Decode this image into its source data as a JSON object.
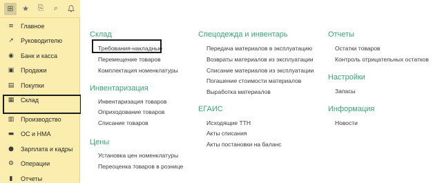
{
  "sidebar": {
    "toolbar": [
      {
        "icon": "grid-icon",
        "glyph": "⊞"
      },
      {
        "icon": "star-icon",
        "glyph": "★"
      },
      {
        "icon": "history-icon",
        "glyph": "⎘"
      },
      {
        "icon": "search-icon",
        "glyph": "⌕"
      },
      {
        "icon": "bell-icon",
        "glyph": "🔔"
      }
    ],
    "items": [
      {
        "label": "Главное",
        "glyph": "≡",
        "name": "sidebar-item-main"
      },
      {
        "label": "Руководителю",
        "glyph": "↗",
        "name": "sidebar-item-director"
      },
      {
        "label": "Банк и касса",
        "glyph": "◉",
        "name": "sidebar-item-bank"
      },
      {
        "label": "Продажи",
        "glyph": "▣",
        "name": "sidebar-item-sales"
      },
      {
        "label": "Покупки",
        "glyph": "▤",
        "name": "sidebar-item-purchases"
      },
      {
        "label": "Склад",
        "glyph": "▦",
        "name": "sidebar-item-warehouse"
      },
      {
        "label": "Производство",
        "glyph": "▥",
        "name": "sidebar-item-production"
      },
      {
        "label": "ОС и НМА",
        "glyph": "▬",
        "name": "sidebar-item-assets"
      },
      {
        "label": "Зарплата и кадры",
        "glyph": "●",
        "name": "sidebar-item-salary"
      },
      {
        "label": "Операции",
        "glyph": "⚙",
        "name": "sidebar-item-operations"
      },
      {
        "label": "Отчеты",
        "glyph": "▮",
        "name": "sidebar-item-reports"
      }
    ],
    "active": "Склад"
  },
  "main": {
    "sections": [
      {
        "title": "Склад",
        "links": [
          "Требования-накладные",
          "Перемещение товаров",
          "Комплектация номенклатуры"
        ]
      },
      {
        "title": "Инвентаризация",
        "links": [
          "Инвентаризация товаров",
          "Оприходование товаров",
          "Списание товаров"
        ]
      },
      {
        "title": "Цены",
        "links": [
          "Установка цен номенклатуры",
          "Переоценка товаров в рознице"
        ]
      },
      {
        "title": "Спецодежда и инвентарь",
        "links": [
          "Передача материалов в эксплуатацию",
          "Возвраты материалов из эксплуатации",
          "Списание материалов из эксплуатации",
          "Погашение стоимости материалов",
          "Выработка материалов"
        ]
      },
      {
        "title": "ЕГАИС",
        "links": [
          "Исходящие ТТН",
          "Акты списания",
          "Акты постановки на баланс"
        ]
      },
      {
        "title": "Отчеты",
        "links": [
          "Остатки товаров",
          "Контроль отрицательных остатков"
        ]
      },
      {
        "title": "Настройки",
        "links": [
          "Запасы"
        ]
      },
      {
        "title": "Информация",
        "links": [
          "Новости"
        ]
      }
    ],
    "highlighted_link": "Требования-накладные"
  }
}
